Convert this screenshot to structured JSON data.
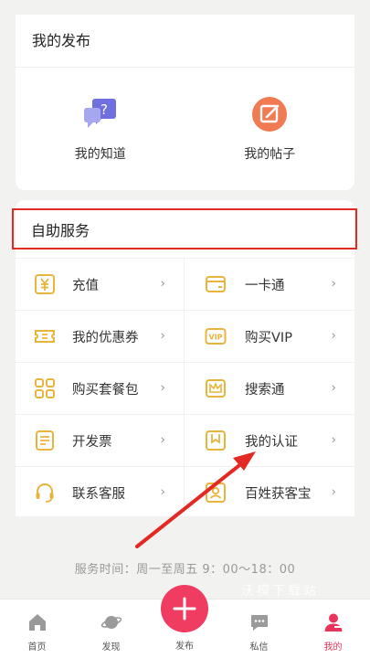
{
  "publish": {
    "title": "我的发布",
    "items": [
      {
        "label": "我的知道",
        "icon": "question-chat-icon"
      },
      {
        "label": "我的帖子",
        "icon": "edit-post-icon"
      }
    ]
  },
  "service": {
    "title": "自助服务",
    "items": [
      {
        "label": "充值",
        "icon": "yuan-icon"
      },
      {
        "label": "一卡通",
        "icon": "card-icon"
      },
      {
        "label": "我的优惠券",
        "icon": "coupon-icon"
      },
      {
        "label": "购买VIP",
        "icon": "vip-icon"
      },
      {
        "label": "购买套餐包",
        "icon": "grid-package-icon"
      },
      {
        "label": "搜索通",
        "icon": "crown-icon"
      },
      {
        "label": "开发票",
        "icon": "invoice-icon"
      },
      {
        "label": "我的认证",
        "icon": "bookmark-icon"
      },
      {
        "label": "联系客服",
        "icon": "headset-icon"
      },
      {
        "label": "百姓获客宝",
        "icon": "customer-icon"
      }
    ],
    "chevron": "›"
  },
  "service_time": "服务时间：周一至周五 9：00～18：00",
  "watermark": "沃模下载站",
  "tabbar": {
    "items": [
      {
        "label": "首页",
        "icon": "home-icon"
      },
      {
        "label": "发现",
        "icon": "planet-icon"
      },
      {
        "label": "发布",
        "icon": "plus-icon"
      },
      {
        "label": "私信",
        "icon": "message-icon"
      },
      {
        "label": "我的",
        "icon": "user-icon"
      }
    ],
    "active": "我的"
  },
  "colors": {
    "accent": "#ef3c60",
    "icon_yellow": "#e9b43c",
    "highlight_red": "#e32924",
    "publish_purple": "#6f6fe0",
    "publish_orange": "#f07a52"
  }
}
